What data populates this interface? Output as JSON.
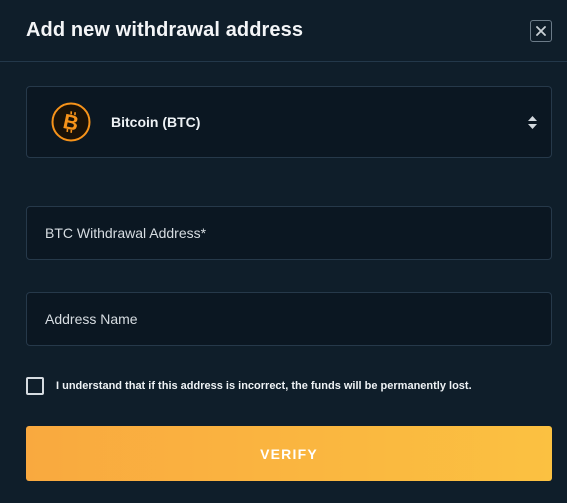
{
  "modal": {
    "title": "Add new withdrawal address",
    "close_icon": "close-icon"
  },
  "currency_select": {
    "icon": "bitcoin-icon",
    "selected": "Bitcoin (BTC)",
    "arrow_icon": "sort-arrows-icon"
  },
  "fields": {
    "address_placeholder": "BTC Withdrawal Address*",
    "address_value": "",
    "name_placeholder": "Address Name",
    "name_value": ""
  },
  "consent": {
    "checked": false,
    "label": "I understand that if this address is incorrect, the funds will be permanently lost."
  },
  "actions": {
    "verify_label": "VERIFY"
  },
  "colors": {
    "background": "#0f1e2a",
    "input_background": "#0b1722",
    "border": "#26394a",
    "bitcoin": "#f7931a",
    "button_gradient_start": "#f9a93f",
    "button_gradient_end": "#fbc141"
  }
}
